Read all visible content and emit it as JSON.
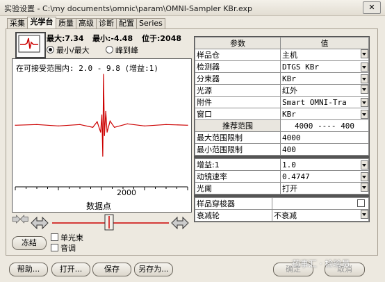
{
  "window": {
    "title": "实验设置 - C:\\my documents\\omnic\\param\\OMNI-Sampler KBr.exp",
    "close_label": "✕"
  },
  "tabs": [
    {
      "label": "采集",
      "active": false
    },
    {
      "label": "光学台",
      "active": true
    },
    {
      "label": "质量",
      "active": false
    },
    {
      "label": "高级",
      "active": false
    },
    {
      "label": "诊断",
      "active": false
    },
    {
      "label": "配置",
      "active": false
    },
    {
      "label": "Series",
      "active": false
    }
  ],
  "stats": {
    "max": "最大:7.34",
    "min": "最小:-4.48",
    "pos": "位于:2048"
  },
  "radios": [
    {
      "label": "最小/最大",
      "selected": true
    },
    {
      "label": "峰到峰",
      "selected": false
    }
  ],
  "plot": {
    "caption": "在可接受范围内: 2.0 - 9.8 (增益:1)",
    "x_tick": "2000",
    "x_label": "数据点"
  },
  "chart_data": {
    "type": "line",
    "title": "",
    "xlabel": "数据点",
    "ylabel": "",
    "x_tick_labels": [
      "2000"
    ],
    "series": [
      {
        "name": "",
        "x": [
          0,
          500,
          1000,
          1500,
          1800,
          1900,
          1980,
          2010,
          2030,
          2048,
          2070,
          2100,
          2130,
          2200,
          2300,
          2600,
          3000,
          3500,
          4000
        ],
        "y": [
          0,
          0.1,
          -0.1,
          0.1,
          -0.3,
          0.5,
          -1.0,
          1.5,
          -4.48,
          7.34,
          -1.5,
          2.0,
          -1.0,
          0.6,
          -0.3,
          0.2,
          -0.1,
          0.1,
          0
        ]
      }
    ],
    "ylim": [
      -4.48,
      7.34
    ]
  },
  "controls": {
    "freeze_label": "冻结",
    "single_beam_label": "单光束",
    "audio_label": "音调"
  },
  "grid": {
    "head_param": "参数",
    "head_value": "值",
    "rows1": [
      {
        "param": "样品仓",
        "value": "主机"
      },
      {
        "param": "检测器",
        "value": "DTGS KBr"
      },
      {
        "param": "分束器",
        "value": "KBr"
      },
      {
        "param": "光源",
        "value": "红外"
      },
      {
        "param": "附件",
        "value": "Smart OMNI-Tra"
      },
      {
        "param": "窗口",
        "value": "KBr"
      }
    ],
    "range_title": "推荐范围",
    "range_hi": "4000",
    "range_dash": "----",
    "range_lo": "400",
    "max_label": "最大范围限制",
    "max_value": "4000",
    "min_label": "最小范围限制",
    "min_value": "400",
    "rows2": [
      {
        "param": "增益:1",
        "value": "1.0"
      },
      {
        "param": "动镜速率",
        "value": "0.4747"
      },
      {
        "param": "光阑",
        "value": "打开"
      }
    ],
    "rows3": [
      {
        "param": "样品穿梭器",
        "value": ""
      },
      {
        "param": "衰减轮",
        "value": "不衰减"
      }
    ]
  },
  "buttons": {
    "help": "帮助...",
    "open": "打开...",
    "save": "保存",
    "save_as": "另存为...",
    "ok": "确定",
    "cancel": "取消"
  },
  "watermark": "药事汇 · 检验员"
}
